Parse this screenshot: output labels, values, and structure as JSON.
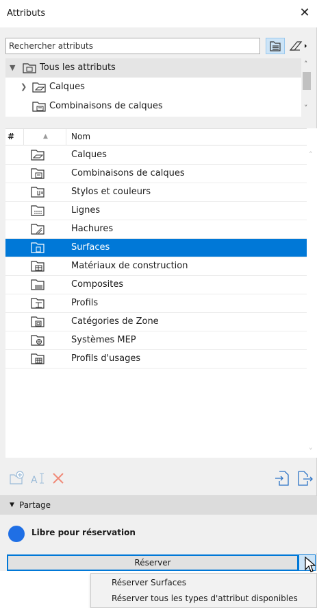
{
  "window": {
    "title": "Attributs",
    "close": "✕"
  },
  "search": {
    "placeholder": "Rechercher attributs"
  },
  "tree": {
    "items": [
      {
        "label": "Tous les attributs"
      },
      {
        "label": "Calques"
      },
      {
        "label": "Combinaisons de calques"
      }
    ]
  },
  "list": {
    "col_hash": "#",
    "col_name": "Nom",
    "rows": [
      {
        "label": "Calques",
        "icon": "layers-icon"
      },
      {
        "label": "Combinaisons de calques",
        "icon": "layer-combinations-icon"
      },
      {
        "label": "Stylos et couleurs",
        "icon": "pens-colors-icon"
      },
      {
        "label": "Lignes",
        "icon": "lines-icon"
      },
      {
        "label": "Hachures",
        "icon": "fills-icon"
      },
      {
        "label": "Surfaces",
        "icon": "surfaces-icon"
      },
      {
        "label": "Matériaux de construction",
        "icon": "building-materials-icon"
      },
      {
        "label": "Composites",
        "icon": "composites-icon"
      },
      {
        "label": "Profils",
        "icon": "profiles-icon"
      },
      {
        "label": "Catégories de Zone",
        "icon": "zone-categories-icon"
      },
      {
        "label": "Systèmes MEP",
        "icon": "mep-systems-icon"
      },
      {
        "label": "Profils d'usages",
        "icon": "operation-profiles-icon"
      }
    ],
    "selected_index": 5
  },
  "section": {
    "label": "Partage"
  },
  "status": {
    "text": "Libre pour réservation",
    "color": "#1f6fe5"
  },
  "reserve": {
    "label": "Réserver"
  },
  "menu": {
    "items": [
      {
        "label": "Réserver Surfaces"
      },
      {
        "label": "Réserver tous les types d'attribut disponibles"
      }
    ]
  },
  "colors": {
    "accent": "#0078d7",
    "selection": "#0078d7"
  }
}
